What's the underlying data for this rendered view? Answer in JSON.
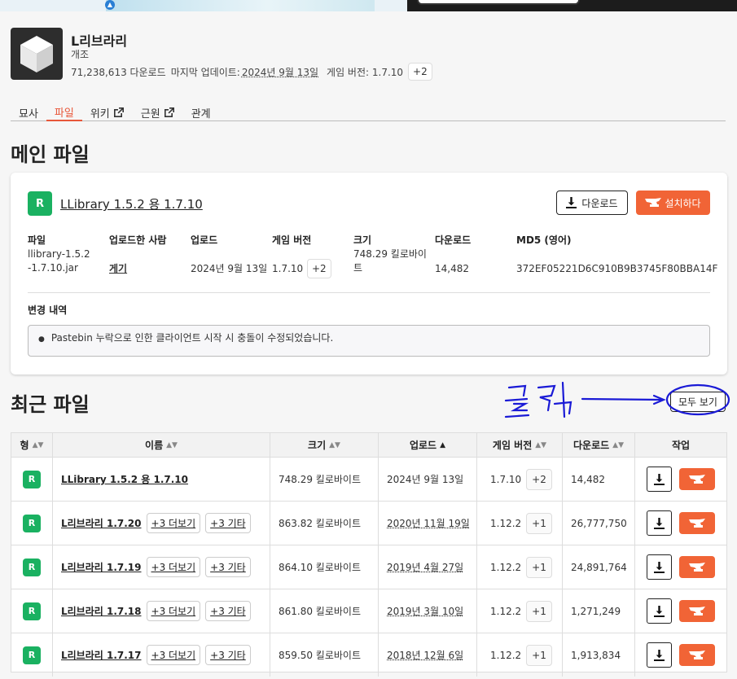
{
  "project": {
    "title": "L리브라리",
    "category": "개조",
    "downloads": "71,238,613 다운로드",
    "updated_label": "마지막 업데이트:",
    "updated_date": "2024년 9월 13일",
    "version_label": "게임 버전: 1.7.10",
    "version_more": "+2"
  },
  "tabs": [
    "묘사",
    "파일",
    "위키",
    "근원",
    "관계"
  ],
  "main_heading": "메인 파일",
  "main_file": {
    "badge": "R",
    "title": "LLibrary 1.5.2 용 1.7.10",
    "download_label": "다운로드",
    "install_label": "설치하다",
    "headers": [
      "파일",
      "업로드한 사람",
      "업로드",
      "게임 버전",
      "크기",
      "다운로드",
      "MD5 (영어)"
    ],
    "file": "llibrary-1.5.2-1.7.10.jar",
    "uploader": "게기",
    "uploaded": "2024년 9월 13일",
    "version": "1.7.10",
    "version_more": "+2",
    "size": "748.29 킬로바이트",
    "downloads": "14,482",
    "md5": "372EF05221D6C910B9B3745F80BBA14F",
    "changelog_label": "변경 내역",
    "changelog": "Pastebin 누락으로 인한 클라이언트 시작 시 충돌이 수정되었습니다."
  },
  "recent_heading": "최근 파일",
  "view_all": "모두 보기",
  "annotation": "클릭",
  "columns": [
    "형",
    "이름",
    "크기",
    "업로드",
    "게임 버전",
    "다운로드",
    "작업"
  ],
  "rows": [
    {
      "badge": "R",
      "name": "LLibrary 1.5.2 용 1.7.10",
      "more": "",
      "other": "",
      "size": "748.29 킬로바이트",
      "date": "2024년 9월 13일",
      "version": "1.7.10",
      "vmore": "+2",
      "downloads": "14,482"
    },
    {
      "badge": "R",
      "name": "L리브라리 1.7.20",
      "more": "+3 더보기",
      "other": "+3 기타",
      "size": "863.82 킬로바이트",
      "date": "2020년 11월 19일",
      "version": "1.12.2",
      "vmore": "+1",
      "downloads": "26,777,750"
    },
    {
      "badge": "R",
      "name": "L리브라리 1.7.19",
      "more": "+3 더보기",
      "other": "+3 기타",
      "size": "864.10 킬로바이트",
      "date": "2019년 4월 27일",
      "version": "1.12.2",
      "vmore": "+1",
      "downloads": "24,891,764"
    },
    {
      "badge": "R",
      "name": "L리브라리 1.7.18",
      "more": "+3 더보기",
      "other": "+3 기타",
      "size": "861.80 킬로바이트",
      "date": "2019년 3월 10일",
      "version": "1.12.2",
      "vmore": "+1",
      "downloads": "1,271,249"
    },
    {
      "badge": "R",
      "name": "L리브라리 1.7.17",
      "more": "+3 더보기",
      "other": "+3 기타",
      "size": "859.50 킬로바이트",
      "date": "2018년 12월 6일",
      "version": "1.12.2",
      "vmore": "+1",
      "downloads": "1,913,834"
    }
  ],
  "colors": {
    "accent": "#f16436",
    "release_badge": "#1ab161",
    "annotation": "#1a1ad6"
  }
}
